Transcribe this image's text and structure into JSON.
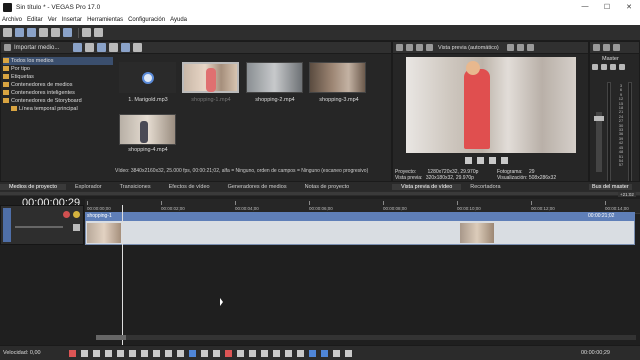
{
  "window": {
    "title": "Sin título * - VEGAS Pro 17.0",
    "minimize": "—",
    "maximize": "☐",
    "close": "✕"
  },
  "menu": [
    "Archivo",
    "Editar",
    "Ver",
    "Insertar",
    "Herramientas",
    "Configuración",
    "Ayuda"
  ],
  "media_panel": {
    "import_label": "Importar medio...",
    "tree": [
      "Todos los medios",
      "Por tipo",
      "Etiquetas",
      "Contenedores de medios",
      "Contenedores inteligentes",
      "Contenedores de Storyboard",
      "Línea temporal principal"
    ],
    "items": [
      {
        "name": "1. Marigold.mp3",
        "icon": "audio-file-icon"
      },
      {
        "name": "shopping-1.mp4",
        "icon": "video-thumbnail"
      },
      {
        "name": "shopping-2.mp4",
        "icon": "video-thumbnail"
      },
      {
        "name": "shopping-3.mp4",
        "icon": "video-thumbnail"
      },
      {
        "name": "shopping-4.mp4",
        "icon": "video-thumbnail"
      }
    ],
    "status_line": "Vídeo: 3840x2160x32, 25.000 fps, 00:00:21;02, alfa = Ninguno, orden de campos = Ninguno (escaneo progresivo)"
  },
  "bottom_tabs": [
    "Medios de proyecto",
    "Explorador",
    "Transiciones",
    "Efectos de vídeo",
    "Generadores de medios",
    "Notas de proyecto"
  ],
  "preview": {
    "header": "Vista previa (automático)",
    "proyecto_label": "Proyecto:",
    "proyecto_value": "1280x720x32, 29.970p",
    "vista_label": "Vista previa:",
    "vista_value": "320x180x32, 29.970p",
    "fotograma_label": "Fotograma:",
    "fotograma_value": "29",
    "visualizacion_label": "Visualización:",
    "visualizacion_value": "508x286x32",
    "tabs": [
      "Vista previa de vídeo",
      "Recortadora"
    ]
  },
  "master": {
    "label": "Master",
    "tab": "Bus del master",
    "scale": [
      "3",
      "6",
      "9",
      "12",
      "15",
      "18",
      "21",
      "24",
      "27",
      "30",
      "33",
      "36",
      "39",
      "42",
      "45",
      "48",
      "51",
      "54",
      "57"
    ]
  },
  "timeline": {
    "timecode": "00:00:00;29",
    "ruler": [
      "00:00:00;00",
      "00:00:02;00",
      "00:00:04;00",
      "00:00:06;00",
      "00:00:08;00",
      "00:00:10;00",
      "00:00:12;00",
      "00:00:14;00"
    ],
    "clip_name": "shopping-1",
    "clip_end": "00:00:21;02",
    "ruler_end": "+21:02",
    "speed_label": "Velocidad: 0,00",
    "status_timecode": "00:00:00;29"
  },
  "colors": {
    "accent": "#5f7fb8",
    "titlebar": "#ffffff",
    "panel": "#262626"
  }
}
